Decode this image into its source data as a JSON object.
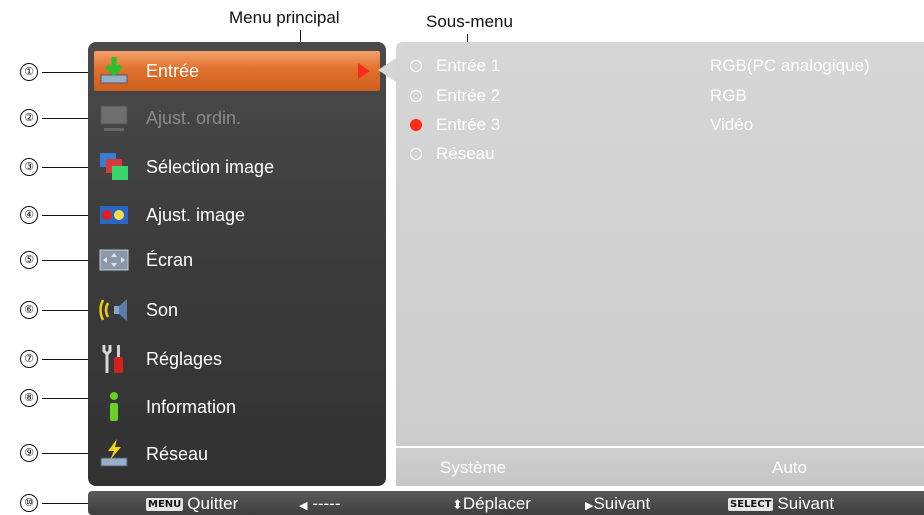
{
  "labels": {
    "main_menu": "Menu principal",
    "sub_menu": "Sous-menu"
  },
  "callouts": [
    "①",
    "②",
    "③",
    "④",
    "⑤",
    "⑥",
    "⑦",
    "⑧",
    "⑨",
    "⑩"
  ],
  "main_menu": {
    "items": [
      {
        "label": "Entrée",
        "icon": "input-icon",
        "state": "selected"
      },
      {
        "label": "Ajust. ordin.",
        "icon": "pc-adjust-icon",
        "state": "disabled"
      },
      {
        "label": "Sélection image",
        "icon": "image-select-icon",
        "state": "normal"
      },
      {
        "label": "Ajust. image",
        "icon": "image-adjust-icon",
        "state": "normal"
      },
      {
        "label": "Écran",
        "icon": "screen-icon",
        "state": "normal"
      },
      {
        "label": "Son",
        "icon": "sound-icon",
        "state": "normal"
      },
      {
        "label": "Réglages",
        "icon": "settings-icon",
        "state": "normal"
      },
      {
        "label": "Information",
        "icon": "information-icon",
        "state": "normal"
      },
      {
        "label": "Réseau",
        "icon": "network-icon",
        "state": "normal"
      }
    ]
  },
  "sub_menu": {
    "items": [
      {
        "label": "Entrée 1",
        "value": "RGB(PC analogique)",
        "selected": false
      },
      {
        "label": "Entrée 2",
        "value": "RGB",
        "selected": false
      },
      {
        "label": "Entrée 3",
        "value": "Vidéo",
        "selected": true
      },
      {
        "label": "Réseau",
        "value": "",
        "selected": false
      }
    ],
    "footer": {
      "label": "Système",
      "value": "Auto"
    }
  },
  "guide_bar": {
    "menu_key": "MENU",
    "quit": "Quitter",
    "back": "-----",
    "move": "Déplacer",
    "next": "Suivant",
    "select_key": "SELECT",
    "select_next": "Suivant"
  },
  "colors": {
    "selected_item": "#e0702c",
    "selection_arrow": "#ff2a1a",
    "active_radio": "#ff2a1a",
    "panel_dark": "#3b3b3b",
    "panel_light": "#d0d0d0"
  }
}
